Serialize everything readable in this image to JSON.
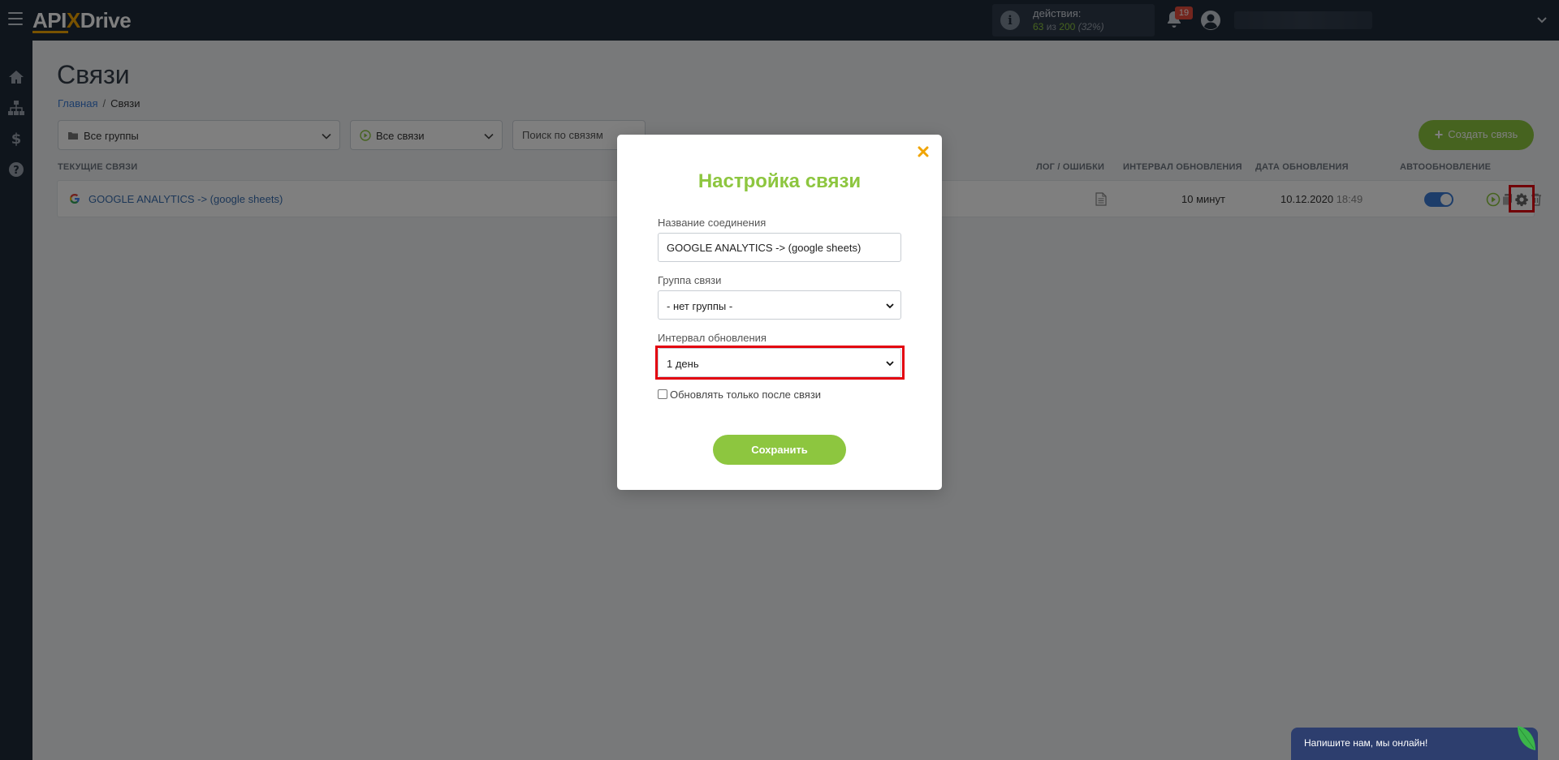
{
  "app": {
    "logo_pre": "API",
    "logo_x": "X",
    "logo_post": "Drive"
  },
  "topbar": {
    "actions_title": "действия:",
    "actions_used": "63",
    "actions_of": "из",
    "actions_total": "200",
    "actions_pct": "(32%)",
    "notifications_count": "19"
  },
  "page": {
    "title": "Связи",
    "breadcrumb": {
      "home": "Главная",
      "separator": "/",
      "current": "Связи"
    }
  },
  "filters": {
    "groups": "Все группы",
    "connections": "Все связи",
    "search_placeholder": "Поиск по связям",
    "create_button": "Создать связь"
  },
  "table": {
    "headers": {
      "current": "ТЕКУЩИЕ СВЯЗИ",
      "log": "ЛОГ / ОШИБКИ",
      "interval": "ИНТЕРВАЛ ОБНОВЛЕНИЯ",
      "date": "ДАТА ОБНОВЛЕНИЯ",
      "auto": "АВТООБНОВЛЕНИЕ"
    },
    "rows": [
      {
        "name": "GOOGLE ANALYTICS -> (google sheets)",
        "interval": "10 минут",
        "date": "10.12.2020",
        "time": "18:49",
        "auto_update": true
      }
    ]
  },
  "modal": {
    "title": "Настройка связи",
    "name_label": "Название соединения",
    "name_value": "GOOGLE ANALYTICS -> (google sheets)",
    "group_label": "Группа связи",
    "group_value": "- нет группы -",
    "interval_label": "Интервал обновления",
    "interval_value": "1 день",
    "checkbox_label": "Обновлять только после связи",
    "save_button": "Сохранить"
  },
  "chat": {
    "text": "Напишите нам, мы онлайн!"
  },
  "colors": {
    "brand_green": "#8dc63f",
    "accent_orange": "#f0a400",
    "highlight_red": "#e3000f",
    "toggle_blue": "#3a7bd5",
    "topbar": "#1f2a38"
  },
  "icons": {
    "sidebar": [
      "home-icon",
      "sitemap-icon",
      "dollar-icon",
      "help-icon"
    ],
    "row_actions": [
      "play-icon",
      "copy-icon",
      "gear-icon",
      "trash-icon"
    ]
  }
}
